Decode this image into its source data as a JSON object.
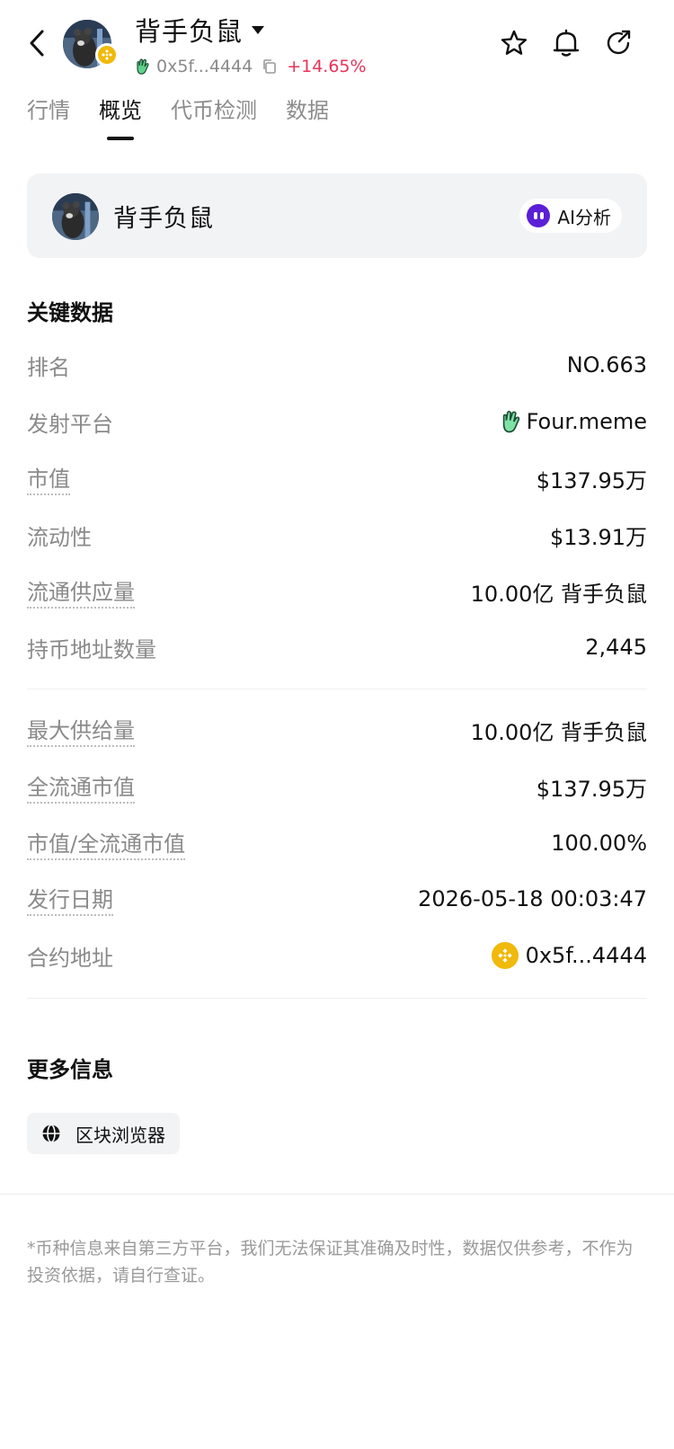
{
  "header": {
    "title": "背手负鼠",
    "address_short": "0x5f...4444",
    "change": "+14.65%",
    "colors": {
      "change": "#e8345a",
      "chain_badge": "#f0b90b"
    },
    "icons": [
      "back-icon",
      "star-icon",
      "bell-icon",
      "share-icon",
      "copy-icon",
      "fourmeme-hand-icon",
      "bsc-chain-icon"
    ]
  },
  "tabs": [
    {
      "label": "行情",
      "active": false
    },
    {
      "label": "概览",
      "active": true
    },
    {
      "label": "代币检测",
      "active": false
    },
    {
      "label": "数据",
      "active": false
    }
  ],
  "token_card": {
    "name": "背手负鼠",
    "ai_label": "AI分析",
    "colors": {
      "ai_accent": "#5b1fd6"
    }
  },
  "key_data": {
    "title": "关键数据",
    "rows": [
      {
        "label": "排名",
        "value": "NO.663"
      },
      {
        "label": "发射平台",
        "value": "Four.meme"
      },
      {
        "label": "市值",
        "value": "$137.95万"
      },
      {
        "label": "流动性",
        "value": "$13.91万"
      },
      {
        "label": "流通供应量",
        "value": "10.00亿 背手负鼠"
      },
      {
        "label": "持币地址数量",
        "value": "2,445"
      }
    ],
    "rows2": [
      {
        "label": "最大供给量",
        "value": "10.00亿 背手负鼠"
      },
      {
        "label": "全流通市值",
        "value": "$137.95万"
      },
      {
        "label": "市值/全流通市值",
        "value": "100.00%"
      },
      {
        "label": "发行日期",
        "value": "2026-05-18 00:03:47"
      },
      {
        "label": "合约地址",
        "value": "0x5f...4444"
      }
    ]
  },
  "more_info": {
    "title": "更多信息",
    "explorer_label": "区块浏览器"
  },
  "disclaimer": "*币种信息来自第三方平台，我们无法保证其准确及时性，数据仅供参考，不作为投资依据，请自行查证。"
}
